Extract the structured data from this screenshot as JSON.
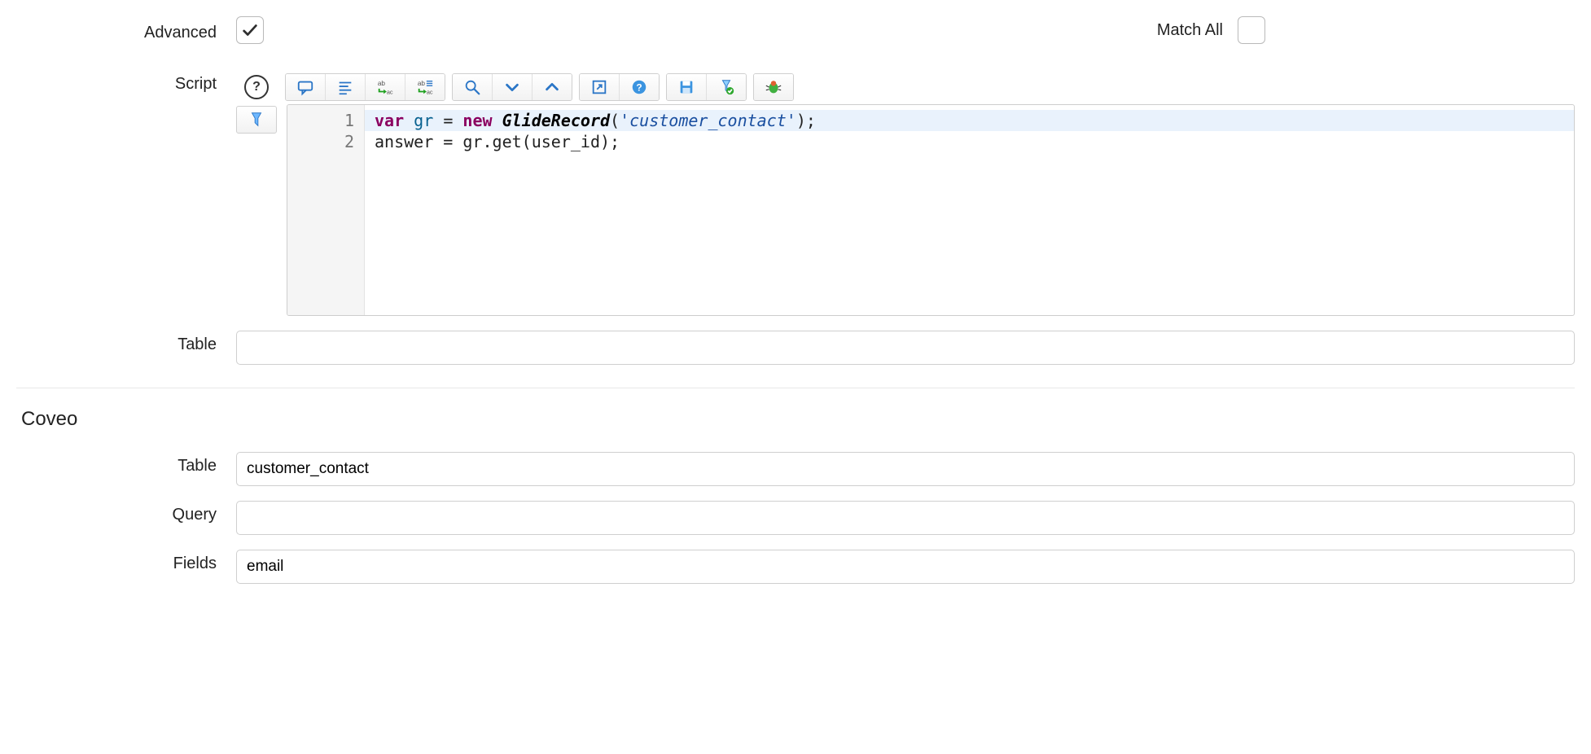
{
  "fields": {
    "advanced_label": "Advanced",
    "advanced_checked": true,
    "match_all_label": "Match All",
    "match_all_checked": false,
    "script_label": "Script",
    "table_label": "Table",
    "table_value": "",
    "coveo_section_title": "Coveo",
    "coveo_table_label": "Table",
    "coveo_table_value": "customer_contact",
    "coveo_query_label": "Query",
    "coveo_query_value": "",
    "coveo_fields_label": "Fields",
    "coveo_fields_value": "email"
  },
  "script_editor": {
    "toolbar_icons": [
      "format-code-icon",
      "comment-icon",
      "align-left-icon",
      "replace-icon",
      "replace-all-icon",
      "search-icon",
      "caret-down-icon",
      "caret-up-icon",
      "popout-icon",
      "help-icon",
      "save-icon",
      "save-check-icon",
      "debug-icon"
    ],
    "line_numbers": [
      "1",
      "2"
    ],
    "code": {
      "line1": {
        "kw_var": "var",
        "sp1": " ",
        "v1": "gr",
        "sp2": " ",
        "eq": "=",
        "sp3": " ",
        "kw_new": "new",
        "sp4": " ",
        "cls": "GlideRecord",
        "paren1": "(",
        "q1": "'",
        "str": "customer_contact",
        "q2": "'",
        "paren2": ")",
        "semi": ";"
      },
      "line2": {
        "v1": "answer",
        "sp1": " ",
        "eq": "=",
        "sp2": " ",
        "v2": "gr",
        "dot": ".",
        "fn": "get",
        "paren1": "(",
        "arg": "user_id",
        "paren2": ")",
        "semi": ";"
      }
    }
  }
}
